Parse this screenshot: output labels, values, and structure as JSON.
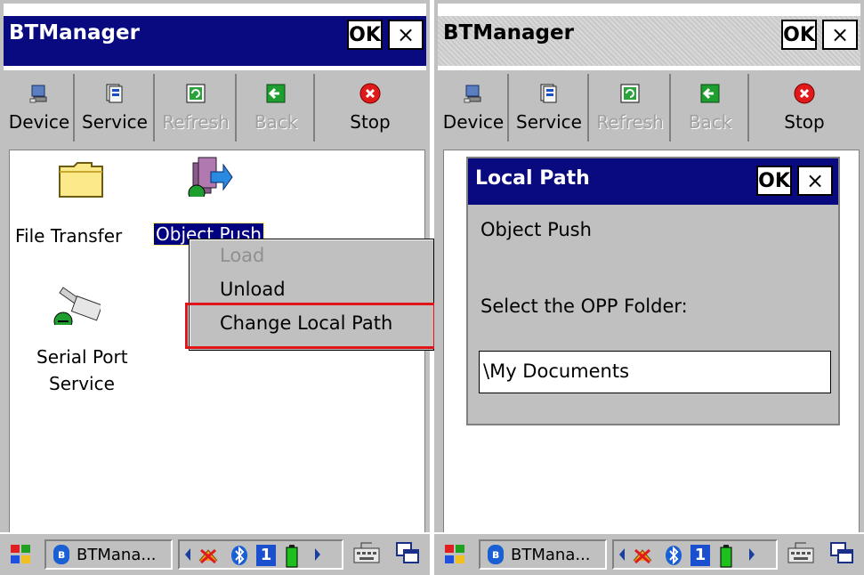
{
  "left": {
    "title": "BTManager",
    "ok_label": "OK",
    "close_label": "×",
    "toolbar": [
      {
        "label": "Device",
        "icon": "device-icon",
        "disabled": false
      },
      {
        "label": "Service",
        "icon": "service-icon",
        "disabled": false
      },
      {
        "label": "Refresh",
        "icon": "refresh-icon",
        "disabled": true
      },
      {
        "label": "Back",
        "icon": "back-arrow-icon",
        "disabled": true
      },
      {
        "label": "Stop",
        "icon": "stop-icon",
        "disabled": false
      }
    ],
    "services": {
      "file_transfer": "File Transfer",
      "object_push": "Object Push",
      "serial_port_line1": "Serial Port",
      "serial_port_line2": "Service"
    },
    "context_menu": {
      "load": "Load",
      "unload": "Unload",
      "change_path": "Change Local Path"
    },
    "taskbar": {
      "task_label": "BTMana...",
      "tray_number": "1"
    }
  },
  "right": {
    "title": "BTManager",
    "ok_label": "OK",
    "close_label": "×",
    "toolbar": [
      {
        "label": "Device",
        "icon": "device-icon",
        "disabled": false
      },
      {
        "label": "Service",
        "icon": "service-icon",
        "disabled": false
      },
      {
        "label": "Refresh",
        "icon": "refresh-icon",
        "disabled": true
      },
      {
        "label": "Back",
        "icon": "back-arrow-icon",
        "disabled": true
      },
      {
        "label": "Stop",
        "icon": "stop-icon",
        "disabled": false
      }
    ],
    "dialog": {
      "title": "Local Path",
      "ok_label": "OK",
      "close_label": "×",
      "service_name": "Object Push",
      "prompt": "Select the OPP Folder:",
      "path_value": "\\My Documents"
    },
    "taskbar": {
      "task_label": "BTMana...",
      "tray_number": "1"
    }
  },
  "colors": {
    "title_active": "#0a0a80",
    "highlight": "#e0151a",
    "system_gray": "#c0c0c0"
  }
}
